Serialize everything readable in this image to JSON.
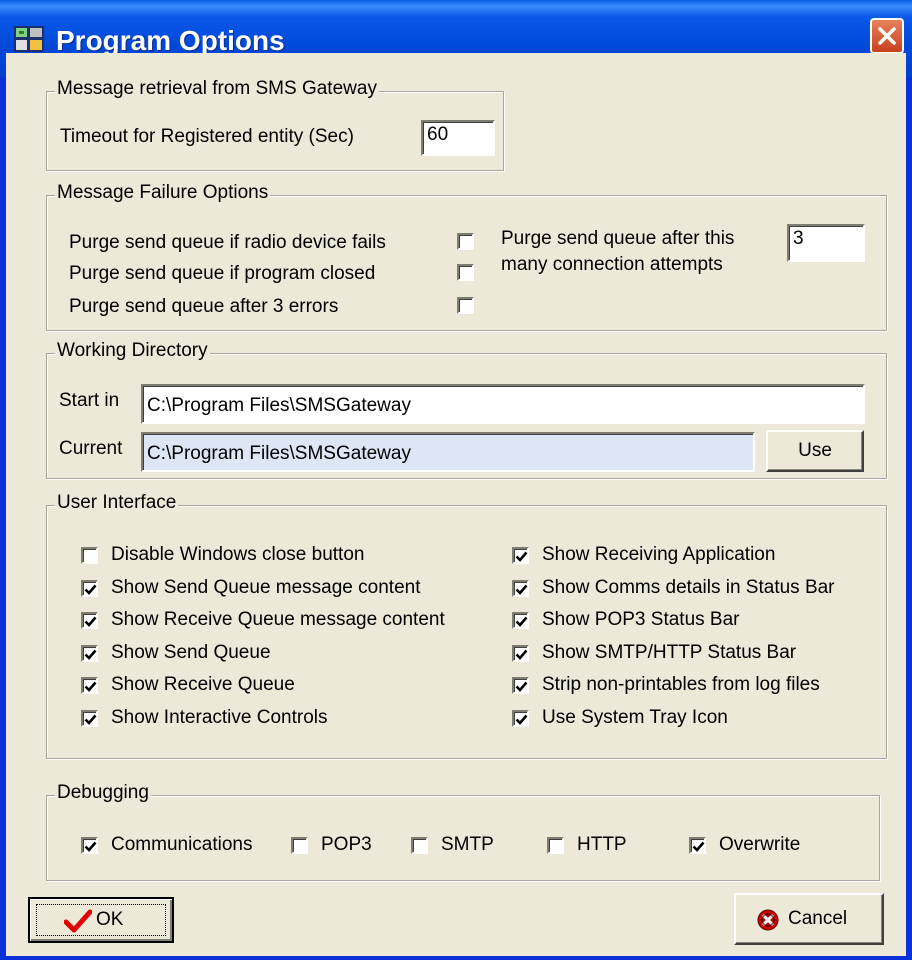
{
  "window": {
    "title": "Program Options",
    "close_icon": "close-x-icon",
    "app_icon": "app-icon"
  },
  "retrieval": {
    "legend": "Message retrieval from SMS Gateway",
    "timeout_label": "Timeout for Registered entity (Sec)",
    "timeout_value": "60"
  },
  "failure": {
    "legend": "Message Failure Options",
    "options": [
      {
        "label": "Purge send queue if radio device fails",
        "checked": false
      },
      {
        "label": "Purge send queue if program closed",
        "checked": false
      },
      {
        "label": "Purge send queue after 3 errors",
        "checked": false
      }
    ],
    "attempts_label_1": "Purge send queue after this",
    "attempts_label_2": "many connection attempts",
    "attempts_value": "3"
  },
  "workdir": {
    "legend": "Working Directory",
    "start_label": "Start in",
    "start_value": "C:\\Program Files\\SMSGateway",
    "current_label": "Current",
    "current_value": "C:\\Program Files\\SMSGateway",
    "use_label": "Use"
  },
  "ui": {
    "legend": "User Interface",
    "left": [
      {
        "label": "Disable Windows close button",
        "checked": false
      },
      {
        "label": "Show Send Queue message content",
        "checked": true
      },
      {
        "label": "Show Receive Queue message content",
        "checked": true
      },
      {
        "label": "Show Send Queue",
        "checked": true
      },
      {
        "label": "Show Receive Queue",
        "checked": true
      },
      {
        "label": "Show Interactive Controls",
        "checked": true
      }
    ],
    "right": [
      {
        "label": "Show Receiving Application",
        "checked": true
      },
      {
        "label": "Show Comms details in Status Bar",
        "checked": true
      },
      {
        "label": "Show POP3 Status Bar",
        "checked": true
      },
      {
        "label": "Show SMTP/HTTP Status Bar",
        "checked": true
      },
      {
        "label": "Strip non-printables from log files",
        "checked": true
      },
      {
        "label": "Use System Tray Icon",
        "checked": true
      }
    ]
  },
  "debug": {
    "legend": "Debugging",
    "items": [
      {
        "label": "Communications",
        "checked": true
      },
      {
        "label": "POP3",
        "checked": false
      },
      {
        "label": "SMTP",
        "checked": false
      },
      {
        "label": "HTTP",
        "checked": false
      },
      {
        "label": "Overwrite",
        "checked": true
      }
    ]
  },
  "buttons": {
    "ok_label": "OK",
    "ok_icon": "checkmark-icon",
    "cancel_label": "Cancel",
    "cancel_icon": "no-entry-icon"
  },
  "colors": {
    "titlebar": "#0048D8",
    "face": "#ECE9D8",
    "current_field": "#DCE6F5",
    "check_red": "#E00000",
    "cancel_red": "#D00000"
  }
}
